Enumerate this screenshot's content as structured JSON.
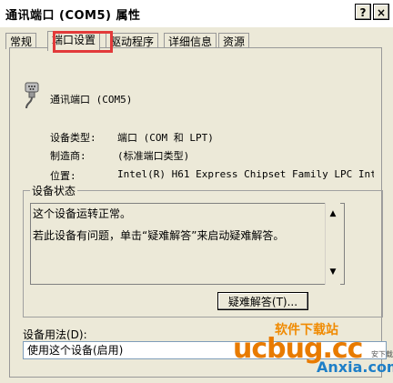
{
  "window": {
    "title": "通讯端口 (COM5) 属性",
    "help_btn": "?",
    "close_btn": "×"
  },
  "tabs": [
    {
      "label": "常规"
    },
    {
      "label": "端口设置"
    },
    {
      "label": "驱动程序"
    },
    {
      "label": "详细信息"
    },
    {
      "label": "资源"
    }
  ],
  "device": {
    "name": "通讯端口 (COM5)",
    "type_label": "设备类型:",
    "type_value": "端口 (COM 和 LPT)",
    "mfr_label": "制造商:",
    "mfr_value": "(标准端口类型)",
    "loc_label": "位置:",
    "loc_value": "Intel(R) H61 Express Chipset Family LPC Int"
  },
  "status": {
    "group_label": "设备状态",
    "line1": "这个设备运转正常。",
    "line2": "若此设备有问题，单击“疑难解答”来启动疑难解答。",
    "troubleshoot_btn": "疑难解答(T)..."
  },
  "usage": {
    "label": "设备用法(D):",
    "value": "使用这个设备(启用)"
  },
  "watermark": {
    "brand": "ucbug.cc",
    "cn_top": "软件下载站",
    "sub": "Anxia.com",
    "tiny": "安下载"
  }
}
